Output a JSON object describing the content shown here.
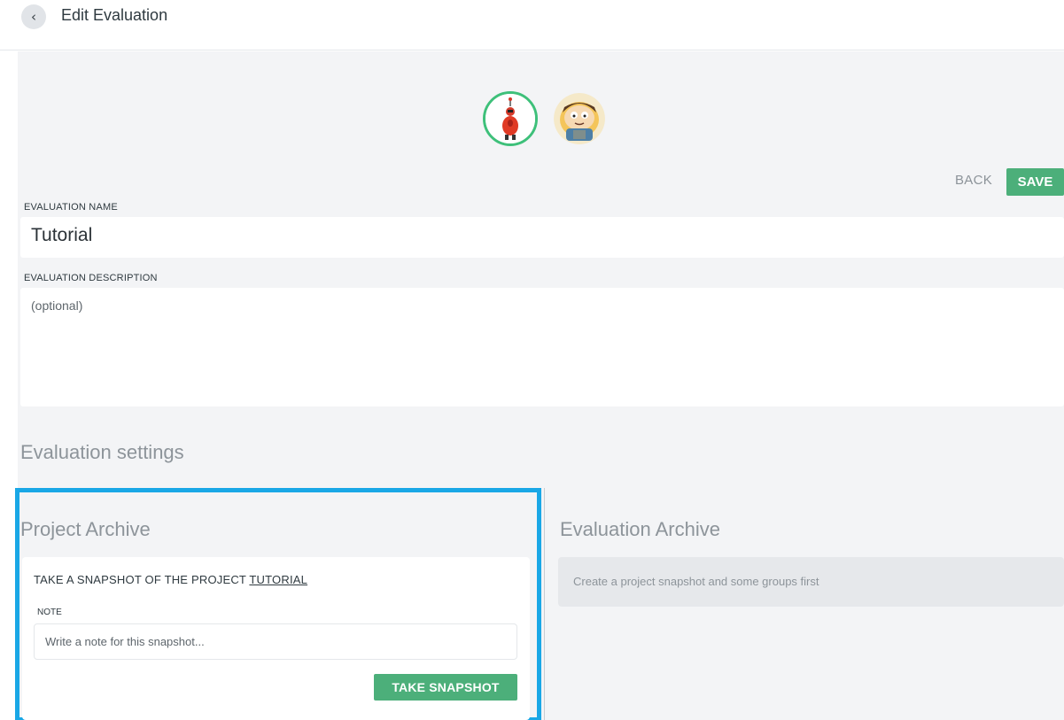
{
  "header": {
    "back_icon": "chevron-left-icon",
    "title": "Edit Evaluation"
  },
  "avatars": [
    {
      "name": "robot-avatar",
      "selected": true
    },
    {
      "name": "boy-avatar",
      "selected": false
    }
  ],
  "actions": {
    "back_label": "BACK",
    "save_label": "SAVE"
  },
  "form": {
    "name_label": "EVALUATION NAME",
    "name_value": "Tutorial",
    "description_label": "EVALUATION DESCRIPTION",
    "description_placeholder": "(optional)"
  },
  "settings": {
    "title": "Evaluation settings",
    "project_archive": {
      "title": "Project Archive",
      "heading_prefix": "TAKE A SNAPSHOT OF THE PROJECT ",
      "project_link": "TUTORIAL",
      "note_label": "NOTE",
      "note_placeholder": "Write a note for this snapshot...",
      "button_label": "TAKE SNAPSHOT"
    },
    "evaluation_archive": {
      "title": "Evaluation Archive",
      "empty_message": "Create a project snapshot and some groups first"
    }
  },
  "colors": {
    "accent_green": "#4caf7a",
    "highlight_blue": "#19a7e6",
    "background": "#f3f4f6"
  }
}
